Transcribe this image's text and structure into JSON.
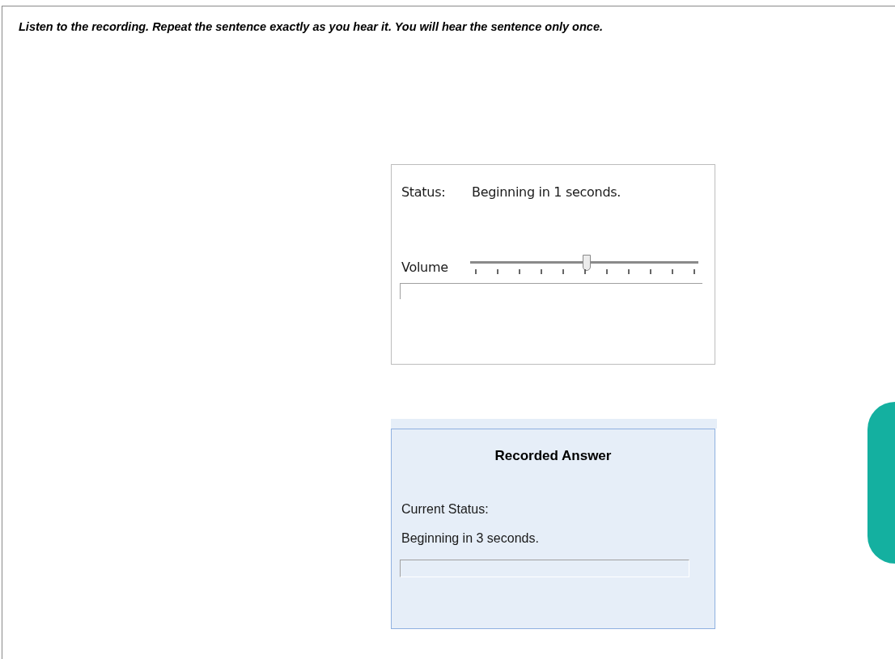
{
  "instruction": "Listen to the recording. Repeat the sentence exactly as you hear it. You will hear the sentence only once.",
  "player": {
    "status_label": "Status:",
    "status_value": "Beginning in 1 seconds.",
    "volume_label": "Volume",
    "volume": {
      "level": 0.51
    },
    "progress": {
      "level": 0
    }
  },
  "recorder": {
    "title": "Recorded Answer",
    "status_label": "Current Status:",
    "status_value": "Beginning in 3 seconds.",
    "progress": {
      "level": 0
    }
  }
}
